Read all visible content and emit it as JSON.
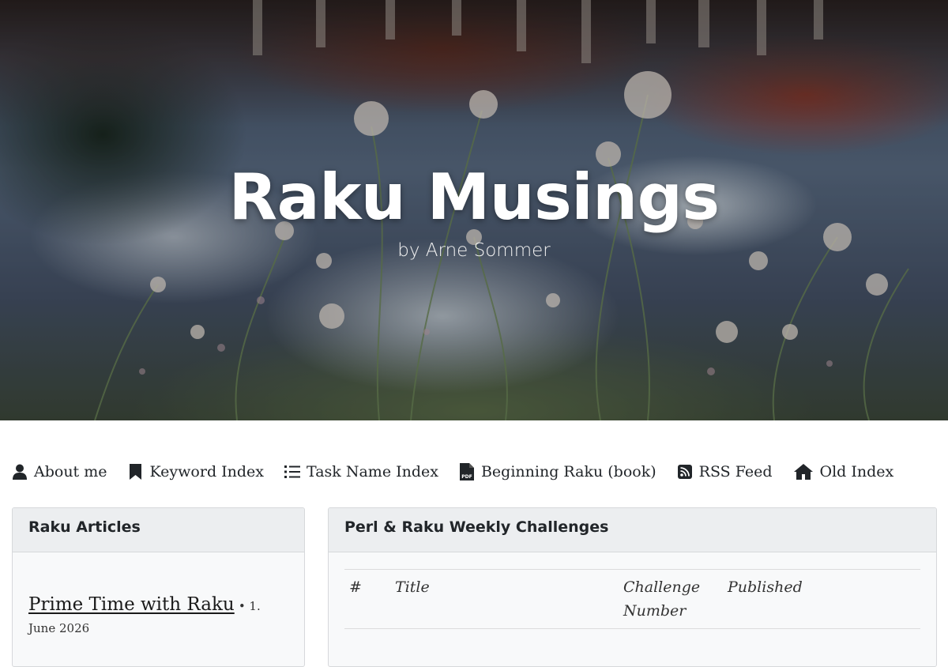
{
  "site": {
    "title": "Raku Musings",
    "subtitle": "by Arne Sommer"
  },
  "nav": {
    "items": [
      {
        "label": "About me",
        "icon": "user-icon"
      },
      {
        "label": "Keyword Index",
        "icon": "bookmark-icon"
      },
      {
        "label": "Task Name Index",
        "icon": "list-icon"
      },
      {
        "label": "Beginning Raku (book)",
        "icon": "pdf-file-icon"
      },
      {
        "label": "RSS Feed",
        "icon": "rss-icon"
      },
      {
        "label": "Old Index",
        "icon": "home-icon"
      }
    ]
  },
  "articles_card": {
    "header": "Raku Articles",
    "items": [
      {
        "title": "Prime Time with Raku",
        "date": "• 1. June 2026"
      }
    ]
  },
  "challenges_card": {
    "header": "Perl & Raku Weekly Challenges",
    "columns": [
      "#",
      "Title",
      "Challenge Number",
      "Published"
    ]
  },
  "colors": {
    "text": "#212529",
    "card_bg": "#f8f9fa",
    "card_header_bg": "#eceef0",
    "border": "#d6d8db"
  }
}
